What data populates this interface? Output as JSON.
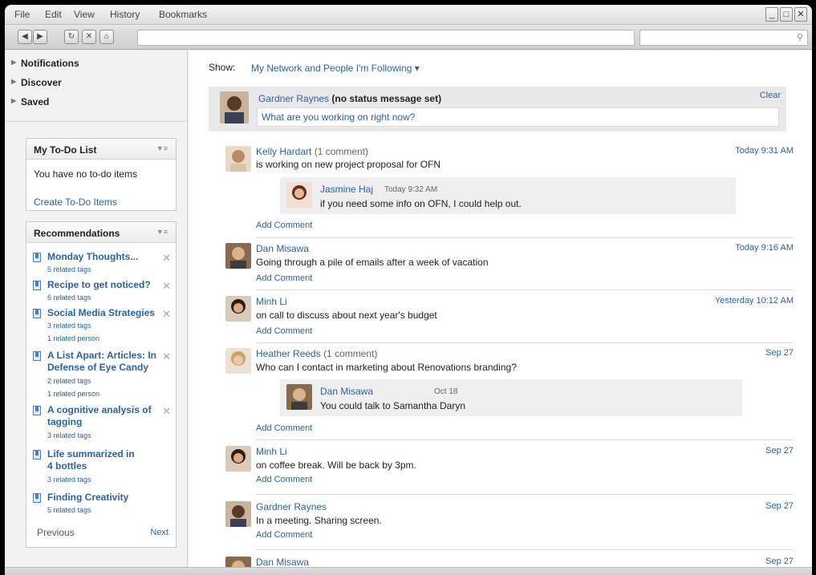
{
  "menubar": {
    "items": [
      "File",
      "Edit",
      "View",
      "History",
      "Bookmarks"
    ],
    "controls": [
      "_",
      "□",
      "✕"
    ]
  },
  "toolbar": {
    "back": "◀",
    "forward": "▶",
    "reload": "↻",
    "stop": "✕",
    "home": "⌂",
    "search_icon": "search-icon"
  },
  "sidebar": {
    "nav": [
      "Notifications",
      "Discover",
      "Saved"
    ],
    "todo": {
      "title": "My To-Do List",
      "empty": "You have no to-do items",
      "create": "Create To-Do Items"
    },
    "recommendations": {
      "title": "Recommendations",
      "items": [
        {
          "title": "Monday Thoughts...",
          "meta": [
            "5 related tags"
          ]
        },
        {
          "title": "Recipe to get noticed?",
          "meta": [
            "6 related tags"
          ]
        },
        {
          "title": "Social Media Strategies",
          "meta": [
            "3 related tags",
            "1 related person"
          ]
        },
        {
          "title": "A List Apart: Articles: In Defense of Eye Candy",
          "meta": [
            "2 related tags",
            "1 related person"
          ]
        },
        {
          "title": "A cognitive analysis of tagging",
          "meta": [
            "3 related tags"
          ]
        },
        {
          "title": "Life summarized in 4 bottles",
          "meta": [
            "3 related tags"
          ]
        },
        {
          "title": "Finding Creativity",
          "meta": [
            "5 related tags"
          ]
        }
      ],
      "previous": "Previous",
      "next": "Next"
    }
  },
  "main": {
    "show_label": "Show:",
    "show_value": "My Network and People I'm Following ▾",
    "status": {
      "name": "Gardner Raynes",
      "status_text": "(no status message set)",
      "clear": "Clear",
      "placeholder": "What are you working on right now?"
    },
    "add_comment": "Add Comment",
    "posts": [
      {
        "name": "Kelly Hardart",
        "extra": "(1 comment)",
        "time": "Today 9:31 AM",
        "msg": "is working on new project proposal for OFN",
        "comment": {
          "name": "Jasmine Haj",
          "time": "Today 9:32 AM",
          "msg": " if you need some info on OFN, I could help out."
        }
      },
      {
        "name": "Dan Misawa",
        "extra": "",
        "time": "Today 9:16 AM",
        "msg": "Going through a pile of emails after a week of vacation"
      },
      {
        "name": "Minh Li",
        "extra": "",
        "time": "Yesterday 10:12 AM",
        "msg": "on call to discuss about next year's budget"
      },
      {
        "name": "Heather Reeds",
        "extra": "(1 comment)",
        "time": "Sep 27",
        "msg": "Who can I contact in marketing about Renovations branding?",
        "comment": {
          "name": "Dan Misawa",
          "time": "Oct 18",
          "msg": "You could talk to Samantha Daryn"
        }
      },
      {
        "name": "Minh Li",
        "extra": "",
        "time": "Sep 27",
        "msg": "on coffee break. Will be back by 3pm."
      },
      {
        "name": "Gardner Raynes",
        "extra": "",
        "time": "Sep 27",
        "msg": "In a meeting. Sharing screen."
      },
      {
        "name": "Dan Misawa",
        "extra": "",
        "time": "Sep 27",
        "msg": ""
      }
    ]
  }
}
